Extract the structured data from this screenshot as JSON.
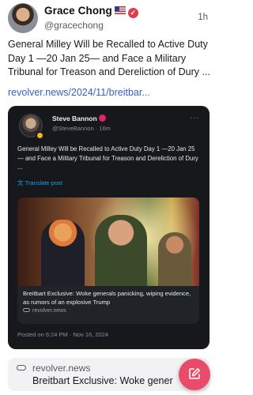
{
  "post": {
    "author_name": "Grace Chong",
    "author_flag": "🇺🇸",
    "handle": "@gracechong",
    "timestamp": "1h",
    "text": "General Milley Will be Recalled to Active Duty Day 1 —20 Jan 25— and Face a Military Tribunal for Treason and Dereliction of Dury ...",
    "link_text": "revolver.news/2024/11/breitbar..."
  },
  "embed": {
    "name": "Steve Bannon",
    "handle": "@SteveBannon · 16m",
    "more": "···",
    "text": "General Milley Will be Recalled to Active Duty Day 1 —20 Jan 25— and Face a Military Tribunal for Treason and Dereliction of Dury ...",
    "translate_label": "Translate post",
    "media_caption": "Breitbart Exclusive: Woke generals panicking, wiping evidence, as rumors of an explosive Trump",
    "media_source": "revolver.news",
    "posted_on": "Posted on 6:24 PM · Nov 16, 2024"
  },
  "link_preview": {
    "domain": "revolver.news",
    "title": "Breitbart Exclusive: Woke generals"
  },
  "colors": {
    "accent": "#ea4b6b",
    "link": "#3b5bc4",
    "embed_bg": "#16181c"
  },
  "icons": {
    "verified": "verified-badge-icon",
    "link": "link-icon",
    "compose": "compose-icon"
  }
}
